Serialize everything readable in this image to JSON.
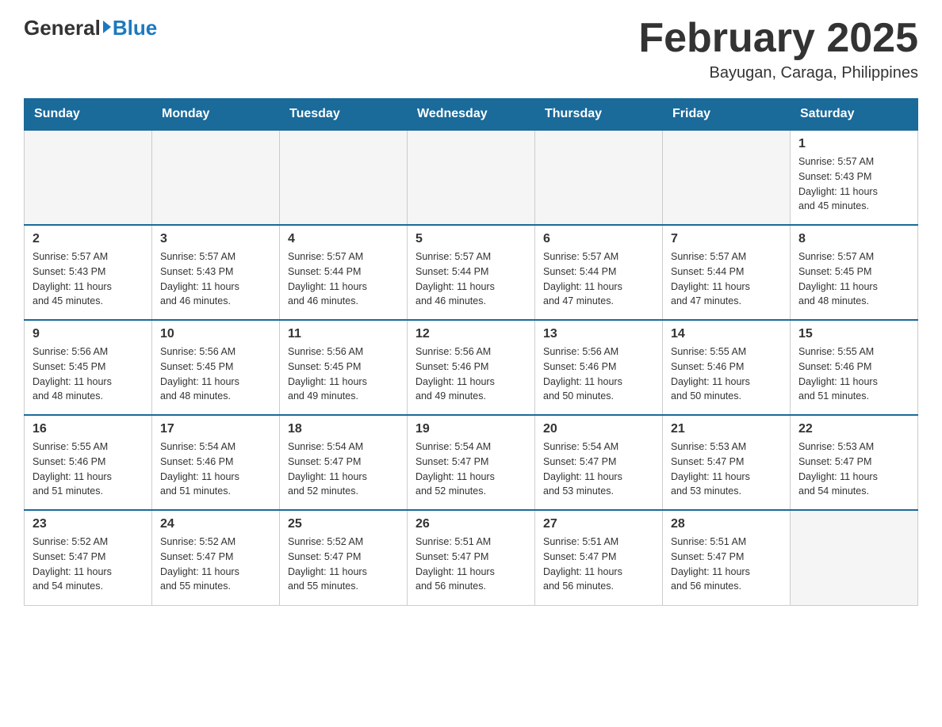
{
  "logo": {
    "general": "General",
    "blue": "Blue"
  },
  "title": "February 2025",
  "subtitle": "Bayugan, Caraga, Philippines",
  "weekdays": [
    "Sunday",
    "Monday",
    "Tuesday",
    "Wednesday",
    "Thursday",
    "Friday",
    "Saturday"
  ],
  "weeks": [
    [
      {
        "day": "",
        "info": ""
      },
      {
        "day": "",
        "info": ""
      },
      {
        "day": "",
        "info": ""
      },
      {
        "day": "",
        "info": ""
      },
      {
        "day": "",
        "info": ""
      },
      {
        "day": "",
        "info": ""
      },
      {
        "day": "1",
        "info": "Sunrise: 5:57 AM\nSunset: 5:43 PM\nDaylight: 11 hours\nand 45 minutes."
      }
    ],
    [
      {
        "day": "2",
        "info": "Sunrise: 5:57 AM\nSunset: 5:43 PM\nDaylight: 11 hours\nand 45 minutes."
      },
      {
        "day": "3",
        "info": "Sunrise: 5:57 AM\nSunset: 5:43 PM\nDaylight: 11 hours\nand 46 minutes."
      },
      {
        "day": "4",
        "info": "Sunrise: 5:57 AM\nSunset: 5:44 PM\nDaylight: 11 hours\nand 46 minutes."
      },
      {
        "day": "5",
        "info": "Sunrise: 5:57 AM\nSunset: 5:44 PM\nDaylight: 11 hours\nand 46 minutes."
      },
      {
        "day": "6",
        "info": "Sunrise: 5:57 AM\nSunset: 5:44 PM\nDaylight: 11 hours\nand 47 minutes."
      },
      {
        "day": "7",
        "info": "Sunrise: 5:57 AM\nSunset: 5:44 PM\nDaylight: 11 hours\nand 47 minutes."
      },
      {
        "day": "8",
        "info": "Sunrise: 5:57 AM\nSunset: 5:45 PM\nDaylight: 11 hours\nand 48 minutes."
      }
    ],
    [
      {
        "day": "9",
        "info": "Sunrise: 5:56 AM\nSunset: 5:45 PM\nDaylight: 11 hours\nand 48 minutes."
      },
      {
        "day": "10",
        "info": "Sunrise: 5:56 AM\nSunset: 5:45 PM\nDaylight: 11 hours\nand 48 minutes."
      },
      {
        "day": "11",
        "info": "Sunrise: 5:56 AM\nSunset: 5:45 PM\nDaylight: 11 hours\nand 49 minutes."
      },
      {
        "day": "12",
        "info": "Sunrise: 5:56 AM\nSunset: 5:46 PM\nDaylight: 11 hours\nand 49 minutes."
      },
      {
        "day": "13",
        "info": "Sunrise: 5:56 AM\nSunset: 5:46 PM\nDaylight: 11 hours\nand 50 minutes."
      },
      {
        "day": "14",
        "info": "Sunrise: 5:55 AM\nSunset: 5:46 PM\nDaylight: 11 hours\nand 50 minutes."
      },
      {
        "day": "15",
        "info": "Sunrise: 5:55 AM\nSunset: 5:46 PM\nDaylight: 11 hours\nand 51 minutes."
      }
    ],
    [
      {
        "day": "16",
        "info": "Sunrise: 5:55 AM\nSunset: 5:46 PM\nDaylight: 11 hours\nand 51 minutes."
      },
      {
        "day": "17",
        "info": "Sunrise: 5:54 AM\nSunset: 5:46 PM\nDaylight: 11 hours\nand 51 minutes."
      },
      {
        "day": "18",
        "info": "Sunrise: 5:54 AM\nSunset: 5:47 PM\nDaylight: 11 hours\nand 52 minutes."
      },
      {
        "day": "19",
        "info": "Sunrise: 5:54 AM\nSunset: 5:47 PM\nDaylight: 11 hours\nand 52 minutes."
      },
      {
        "day": "20",
        "info": "Sunrise: 5:54 AM\nSunset: 5:47 PM\nDaylight: 11 hours\nand 53 minutes."
      },
      {
        "day": "21",
        "info": "Sunrise: 5:53 AM\nSunset: 5:47 PM\nDaylight: 11 hours\nand 53 minutes."
      },
      {
        "day": "22",
        "info": "Sunrise: 5:53 AM\nSunset: 5:47 PM\nDaylight: 11 hours\nand 54 minutes."
      }
    ],
    [
      {
        "day": "23",
        "info": "Sunrise: 5:52 AM\nSunset: 5:47 PM\nDaylight: 11 hours\nand 54 minutes."
      },
      {
        "day": "24",
        "info": "Sunrise: 5:52 AM\nSunset: 5:47 PM\nDaylight: 11 hours\nand 55 minutes."
      },
      {
        "day": "25",
        "info": "Sunrise: 5:52 AM\nSunset: 5:47 PM\nDaylight: 11 hours\nand 55 minutes."
      },
      {
        "day": "26",
        "info": "Sunrise: 5:51 AM\nSunset: 5:47 PM\nDaylight: 11 hours\nand 56 minutes."
      },
      {
        "day": "27",
        "info": "Sunrise: 5:51 AM\nSunset: 5:47 PM\nDaylight: 11 hours\nand 56 minutes."
      },
      {
        "day": "28",
        "info": "Sunrise: 5:51 AM\nSunset: 5:47 PM\nDaylight: 11 hours\nand 56 minutes."
      },
      {
        "day": "",
        "info": ""
      }
    ]
  ]
}
